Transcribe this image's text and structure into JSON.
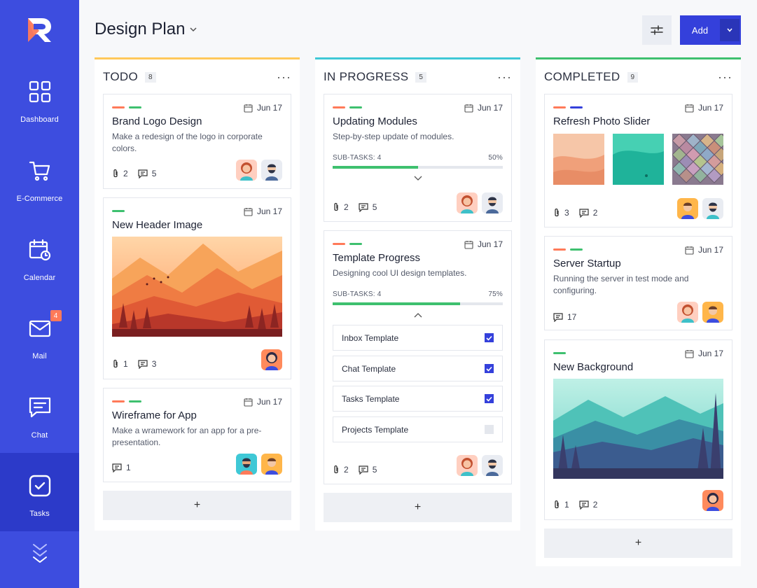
{
  "app": {
    "title": "Design Plan",
    "add_label": "Add"
  },
  "colors": {
    "sidebar": "#3d4ddf",
    "accent": "#3440db",
    "todo": "#ffc85a",
    "in_progress": "#3fc8d6",
    "completed": "#3ec06f",
    "tag_orange": "#ff7a59",
    "tag_green": "#3ec06f",
    "tag_blue": "#3440db"
  },
  "sidebar": {
    "items": [
      {
        "label": "Dashboard",
        "icon": "grid-icon"
      },
      {
        "label": "E-Commerce",
        "icon": "cart-icon"
      },
      {
        "label": "Calendar",
        "icon": "calendar-icon"
      },
      {
        "label": "Mail",
        "icon": "mail-icon",
        "badge": "4"
      },
      {
        "label": "Chat",
        "icon": "chat-icon"
      },
      {
        "label": "Tasks",
        "icon": "tasks-icon",
        "active": true
      }
    ]
  },
  "columns": {
    "todo": {
      "title": "TODO",
      "count": "8",
      "cards": [
        {
          "title": "Brand Logo Design",
          "date": "Jun 17",
          "desc": "Make a redesign of the logo in corporate colors.",
          "attachments": "2",
          "comments": "5"
        },
        {
          "title": "New Header Image",
          "date": "Jun 17",
          "attachments": "1",
          "comments": "3"
        },
        {
          "title": "Wireframe for App",
          "date": "Jun 17",
          "desc": "Make a wramework for an app for a pre-presentation.",
          "comments": "1"
        }
      ],
      "add": "+"
    },
    "in_progress": {
      "title": "IN PROGRESS",
      "count": "5",
      "cards": [
        {
          "title": "Updating Modules",
          "date": "Jun 17",
          "desc": "Step-by-step update of modules.",
          "subtasks_label": "SUB-TASKS: 4",
          "progress_label": "50%",
          "progress": 0.5,
          "attachments": "2",
          "comments": "5"
        },
        {
          "title": "Template Progress",
          "date": "Jun 17",
          "desc": "Designing cool UI design templates.",
          "subtasks_label": "SUB-TASKS: 4",
          "progress_label": "75%",
          "progress": 0.75,
          "attachments": "2",
          "comments": "5",
          "checklist": [
            {
              "label": "Inbox Template",
              "checked": true
            },
            {
              "label": "Chat Template",
              "checked": true
            },
            {
              "label": "Tasks Template",
              "checked": true
            },
            {
              "label": "Projects Template",
              "checked": false
            }
          ]
        }
      ],
      "add": "+"
    },
    "completed": {
      "title": "COMPLETED",
      "count": "9",
      "cards": [
        {
          "title": "Refresh Photo Slider",
          "date": "Jun 17",
          "attachments": "3",
          "comments": "2"
        },
        {
          "title": "Server Startup",
          "date": "Jun 17",
          "desc": "Running the server in test mode and configuring.",
          "comments": "17"
        },
        {
          "title": "New Background",
          "date": "Jun 17",
          "attachments": "1",
          "comments": "2"
        }
      ],
      "add": "+"
    }
  }
}
